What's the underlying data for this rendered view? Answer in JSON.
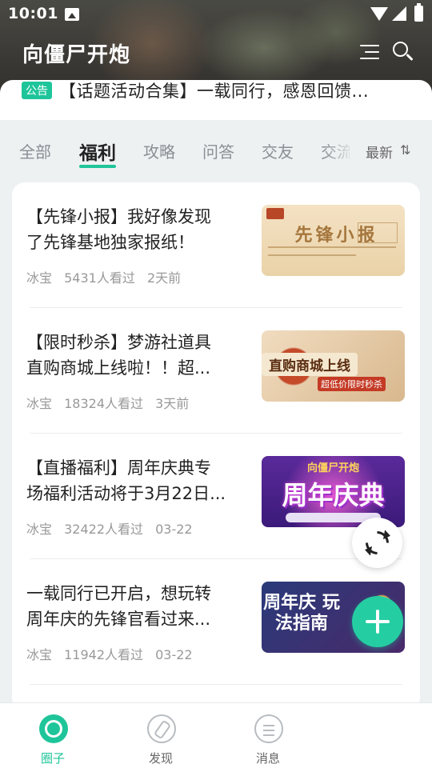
{
  "status_bar": {
    "time": "10:01"
  },
  "header": {
    "title": "向僵尸开炮"
  },
  "notice": {
    "badge": "公告",
    "text": "【话题活动合集】一载同行，感恩回馈..."
  },
  "tabs": [
    {
      "label": "全部",
      "active": false
    },
    {
      "label": "福利",
      "active": true
    },
    {
      "label": "攻略",
      "active": false
    },
    {
      "label": "问答",
      "active": false
    },
    {
      "label": "交友",
      "active": false
    },
    {
      "label": "交流",
      "active": false
    }
  ],
  "sort": {
    "label": "最新",
    "icon": "sort-icon"
  },
  "posts": [
    {
      "title_lines": [
        "【先锋小报】我好像发现",
        "了先锋基地独家报纸！"
      ],
      "author": "冰宝",
      "views": "5431人看过",
      "time": "2天前",
      "thumb_text": "先锋小报"
    },
    {
      "title_lines": [
        "【限时秒杀】梦游社道具",
        "直购商城上线啦！！超..."
      ],
      "author": "冰宝",
      "views": "18324人看过",
      "time": "3天前",
      "thumb_text": "直购商城上线",
      "thumb_sub": "超低价限时秒杀"
    },
    {
      "title_lines": [
        "【直播福利】周年庆典专",
        "场福利活动将于3月22日..."
      ],
      "author": "冰宝",
      "views": "32422人看过",
      "time": "03-22",
      "thumb_text": "向僵尸开炮",
      "thumb_big": "周年庆典"
    },
    {
      "title_lines": [
        "一载同行已开启，想玩转",
        "周年庆的先锋官看过来..."
      ],
      "author": "冰宝",
      "views": "11942人看过",
      "time": "03-22",
      "thumb_text": "周年庆 玩法指南"
    }
  ],
  "bottom_nav": [
    {
      "label": "圈子",
      "active": true
    },
    {
      "label": "发现",
      "active": false
    },
    {
      "label": "消息",
      "active": false
    }
  ],
  "colors": {
    "accent": "#1fc59a",
    "text": "#222222",
    "muted": "#999999",
    "background": "#eef1f2"
  }
}
